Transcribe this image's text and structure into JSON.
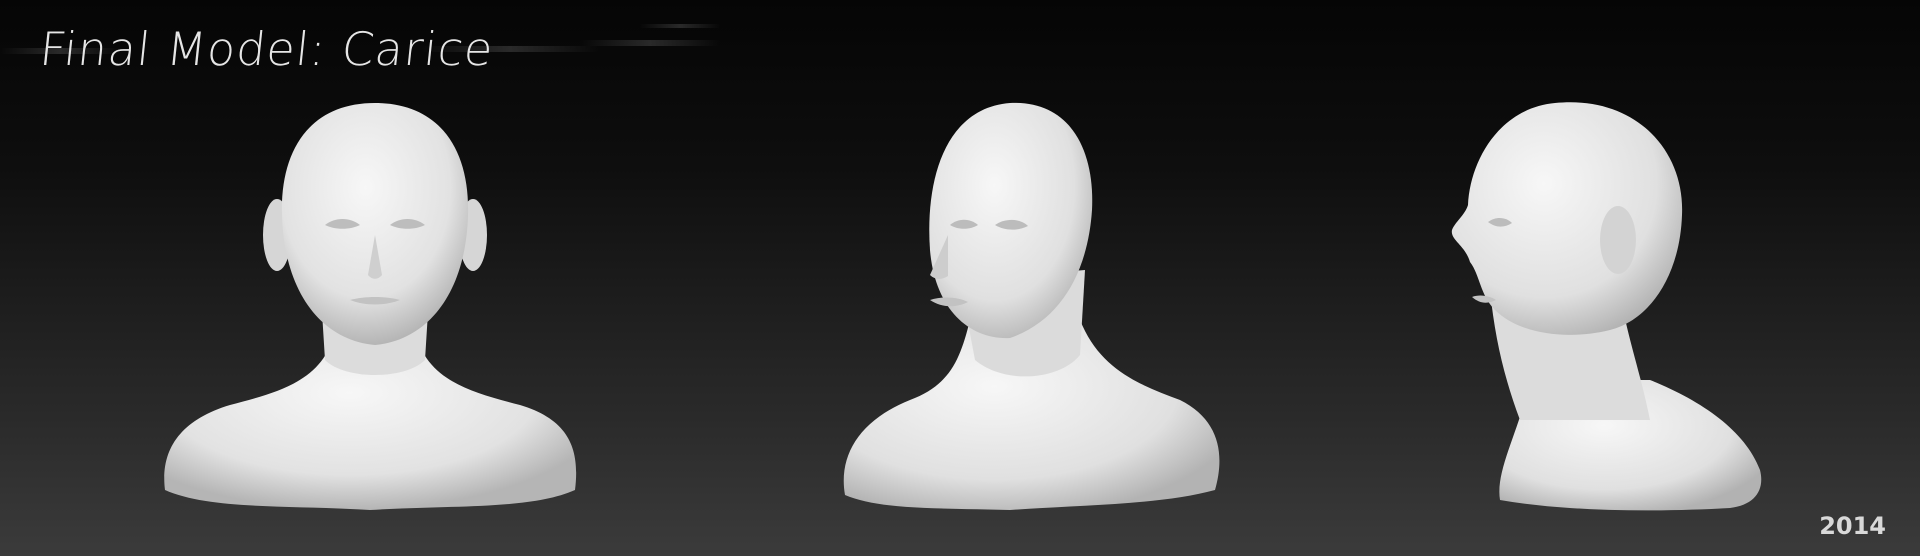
{
  "title": "Final Model: Carice",
  "year": "2014",
  "views": [
    {
      "view": "front",
      "description_icon": "bust-front-icon"
    },
    {
      "view": "three-quarter",
      "description_icon": "bust-three-quarter-icon"
    },
    {
      "view": "profile",
      "description_icon": "bust-profile-icon"
    }
  ],
  "colors": {
    "background_top": "#050505",
    "background_bottom": "#3b3b3b",
    "model_clay": "#ececec",
    "model_shadow": "#b8b8b8",
    "text": "#e6e6e6"
  }
}
